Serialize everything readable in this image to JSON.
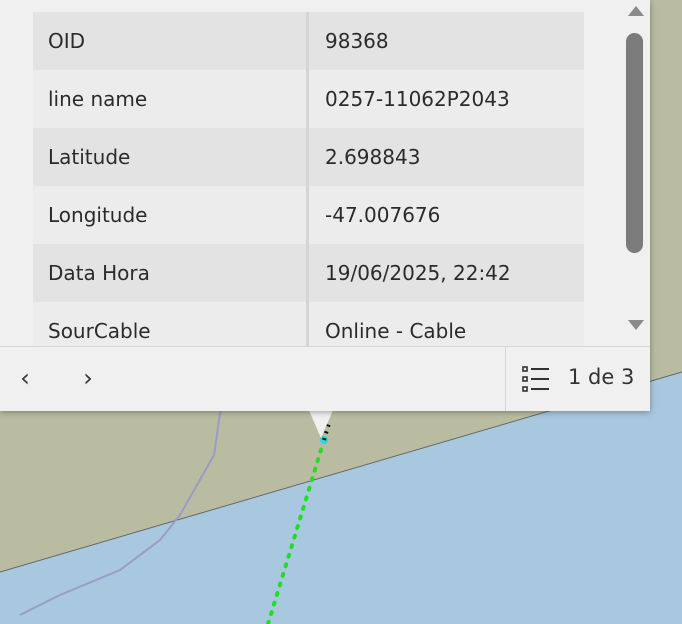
{
  "popup": {
    "fields": [
      {
        "label": "OID",
        "value": "98368"
      },
      {
        "label": "line name",
        "value": "0257-11062P2043"
      },
      {
        "label": "Latitude",
        "value": "2.698843"
      },
      {
        "label": "Longitude",
        "value": "-47.007676"
      },
      {
        "label": "Data Hora",
        "value": "19/06/2025, 22:42"
      },
      {
        "label": "SourCable",
        "value": "Online - Cable"
      }
    ],
    "footer": {
      "prev_label": "‹",
      "next_label": "›",
      "pager_text": "1 de 3",
      "list_icon": "list-icon"
    }
  },
  "colors": {
    "land": "#b9bca0",
    "water": "#a8c8e0",
    "route_green": "#22dd22",
    "boundary_purple": "#9b9bc8"
  }
}
